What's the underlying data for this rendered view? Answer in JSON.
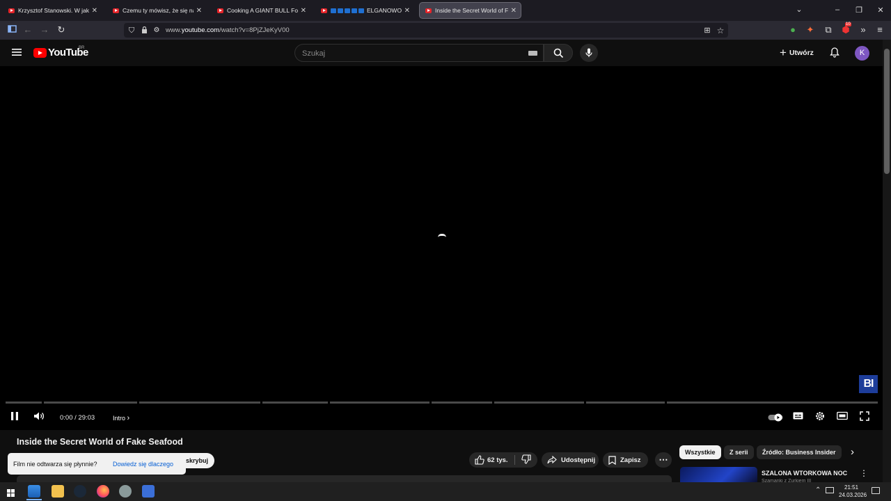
{
  "browser": {
    "tabs": [
      {
        "title": "Krzysztof Stanowski. W jakiej sy"
      },
      {
        "title": "Czemu ty mówisz, że się na ciel"
      },
      {
        "title": "Cooking A GIANT BULL For A G"
      },
      {
        "title": "ELGANOWO: Di"
      },
      {
        "title": "Inside the Secret World of Fake"
      }
    ],
    "url_prefix": "www.",
    "url_domain": "youtube.com",
    "url_path": "/watch?v=8PjZJeKyV00",
    "extension_badge": "10"
  },
  "youtube": {
    "logo_text": "YouTube",
    "region": "BR",
    "search_placeholder": "Szukaj",
    "create_label": "Utwórz",
    "avatar_letter": "K"
  },
  "player": {
    "current_time": "0:00",
    "duration": "29:03",
    "chapter": "Intro",
    "watermark": "BI"
  },
  "video": {
    "title": "Inside the Secret World of Fake Seafood",
    "subscribe_label": "skrybuj",
    "likes": "62 tys.",
    "share_label": "Udostępnij",
    "save_label": "Zapisz"
  },
  "toast": {
    "text": "Film nie odtwarza się płynnie?",
    "link": "Dowiedz się dlaczego"
  },
  "chips": [
    "Wszystkie",
    "Z serii",
    "Źródło: Business Insider"
  ],
  "recommendation": {
    "title": "SZALONA WTORKOWA NOC",
    "channel": "Szamanki z Żurkiem III"
  },
  "taskbar": {
    "time": "21:51",
    "date": "24.03.2026"
  },
  "colors": {
    "youtube_red": "#ff0000",
    "avatar": "#7e57c2",
    "link_blue": "#065fd4",
    "bi_logo": "#1d3d9a"
  }
}
